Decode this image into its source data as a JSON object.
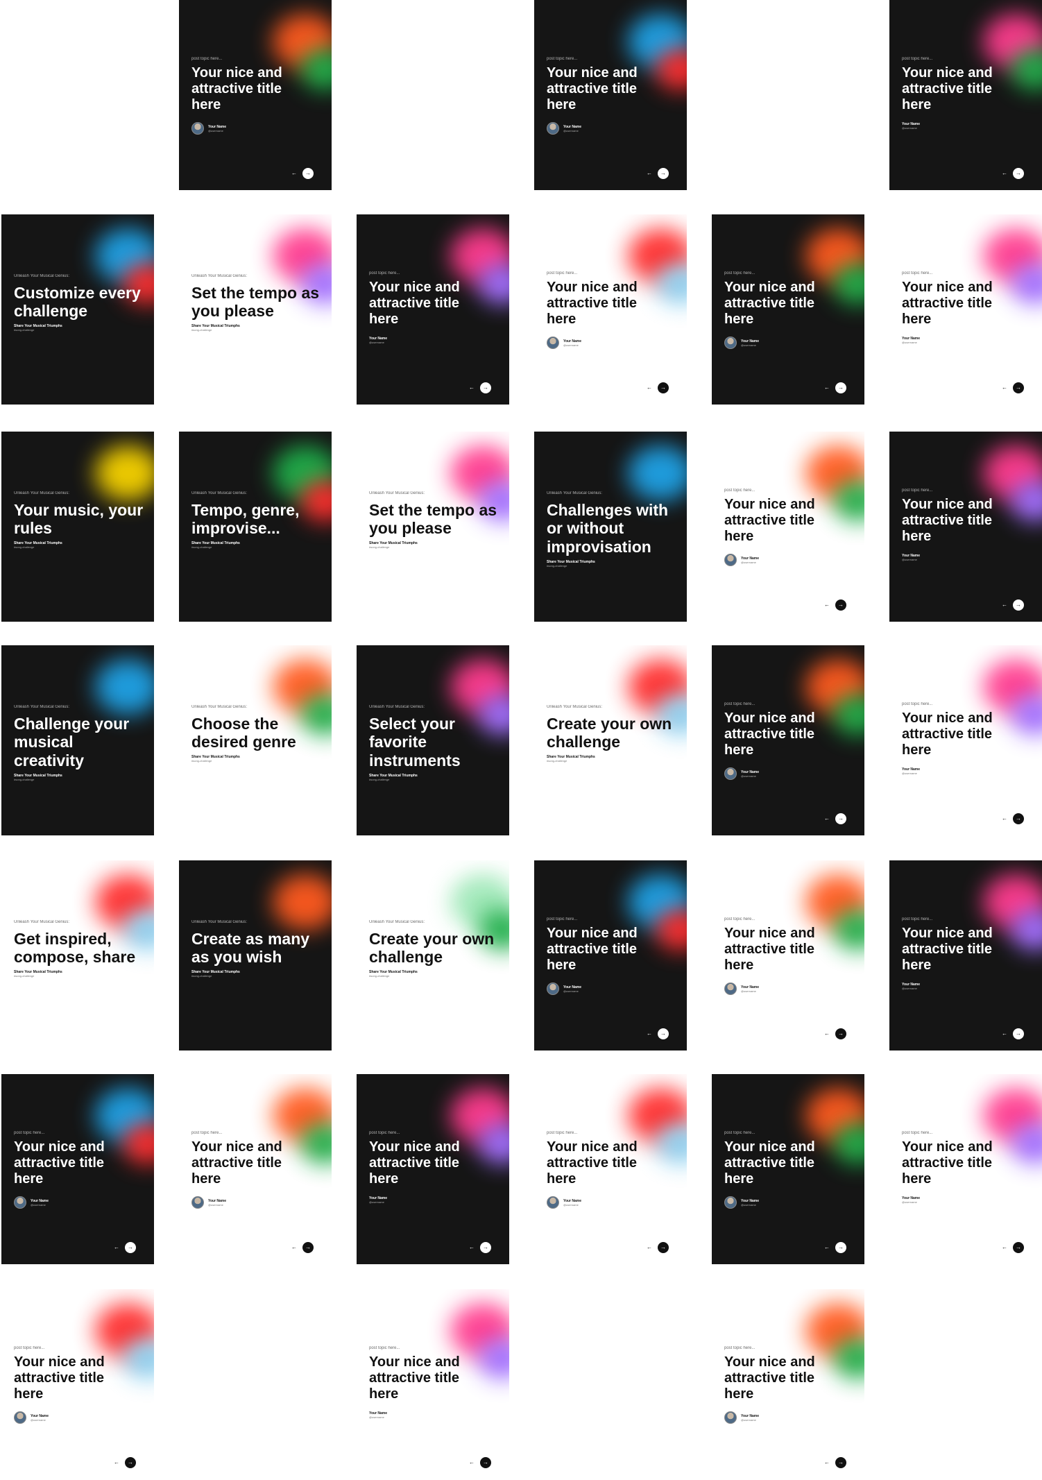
{
  "colors": {
    "dark_bg": "#151515",
    "light_bg": "#ffffff",
    "orange": "#ff5a1f",
    "blue": "#1fa2e6",
    "pink": "#ff3c8e",
    "red": "#ff2d2d",
    "green": "#1fae4a",
    "purple": "#a070ff",
    "yellow": "#f6d200",
    "light_blue": "#8cd0f0",
    "mint": "#9fe8b8"
  },
  "common": {
    "topic": "post topic here...",
    "title": "Your nice and attractive title here",
    "author_name": "Your Name",
    "author_handle": "@username",
    "promo_topic": "Unleash Your Musical Genius:",
    "cta_main": "Share Your Musical Triumphs",
    "cta_tag": "#song-challenge",
    "prev_icon": "←",
    "next_icon": "→"
  },
  "cards": [
    {
      "theme": "dark",
      "kind": "post",
      "palette": [
        "orange",
        "green"
      ],
      "show_avatar": true,
      "show_nav": true
    },
    {
      "theme": "dark",
      "kind": "post",
      "palette": [
        "blue",
        "red"
      ],
      "show_avatar": true,
      "show_nav": true
    },
    {
      "theme": "dark",
      "kind": "post",
      "palette": [
        "pink",
        "green"
      ],
      "show_avatar": false,
      "show_nav": true
    },
    {
      "theme": "dark",
      "kind": "promo",
      "title": "Customize every challenge",
      "palette": [
        "blue",
        "red"
      ]
    },
    {
      "theme": "light",
      "kind": "promo",
      "title": "Set the tempo as you please",
      "palette": [
        "pink",
        "purple"
      ]
    },
    {
      "theme": "dark",
      "kind": "post",
      "palette": [
        "pink",
        "purple"
      ],
      "show_avatar": false,
      "show_nav": true
    },
    {
      "theme": "light",
      "kind": "post",
      "palette": [
        "red",
        "light_blue"
      ],
      "show_avatar": true,
      "show_nav": true
    },
    {
      "theme": "dark",
      "kind": "post",
      "palette": [
        "orange",
        "green"
      ],
      "show_avatar": true,
      "show_nav": true
    },
    {
      "theme": "light",
      "kind": "post",
      "palette": [
        "pink",
        "purple"
      ],
      "show_avatar": false,
      "show_nav": true
    },
    {
      "theme": "dark",
      "kind": "promo",
      "title": "Your music, your rules",
      "palette": [
        "yellow"
      ]
    },
    {
      "theme": "dark",
      "kind": "promo",
      "title": "Tempo, genre, improvise...",
      "palette": [
        "green",
        "red"
      ]
    },
    {
      "theme": "light",
      "kind": "promo",
      "title": "Set the tempo as you please",
      "palette": [
        "pink",
        "purple"
      ]
    },
    {
      "theme": "dark",
      "kind": "promo",
      "title": "Challenges with or without improvisation",
      "palette": [
        "blue"
      ]
    },
    {
      "theme": "light",
      "kind": "post",
      "palette": [
        "orange",
        "green"
      ],
      "show_avatar": true,
      "show_nav": true
    },
    {
      "theme": "dark",
      "kind": "post",
      "palette": [
        "pink",
        "purple"
      ],
      "show_avatar": false,
      "show_nav": true
    },
    {
      "theme": "dark",
      "kind": "promo",
      "title": "Challenge your musical creativity",
      "palette": [
        "blue"
      ]
    },
    {
      "theme": "light",
      "kind": "promo",
      "title": "Choose the desired genre",
      "palette": [
        "orange",
        "green"
      ]
    },
    {
      "theme": "dark",
      "kind": "promo",
      "title": "Select your favorite instruments",
      "palette": [
        "pink",
        "purple"
      ]
    },
    {
      "theme": "light",
      "kind": "promo",
      "title": "Create your own challenge",
      "palette": [
        "red",
        "light_blue"
      ]
    },
    {
      "theme": "dark",
      "kind": "post",
      "palette": [
        "orange",
        "green"
      ],
      "show_avatar": true,
      "show_nav": true
    },
    {
      "theme": "light",
      "kind": "post",
      "palette": [
        "pink",
        "purple"
      ],
      "show_avatar": false,
      "show_nav": true
    },
    {
      "theme": "light",
      "kind": "promo",
      "title": "Get inspired, compose, share",
      "palette": [
        "red",
        "light_blue"
      ]
    },
    {
      "theme": "dark",
      "kind": "promo",
      "title": "Create as many as you wish",
      "palette": [
        "orange"
      ]
    },
    {
      "theme": "light",
      "kind": "promo",
      "title": "Create your own challenge",
      "palette": [
        "mint",
        "green"
      ]
    },
    {
      "theme": "dark",
      "kind": "post",
      "palette": [
        "blue",
        "red"
      ],
      "show_avatar": true,
      "show_nav": true
    },
    {
      "theme": "light",
      "kind": "post",
      "palette": [
        "orange",
        "green"
      ],
      "show_avatar": true,
      "show_nav": true
    },
    {
      "theme": "dark",
      "kind": "post",
      "palette": [
        "pink",
        "purple"
      ],
      "show_avatar": false,
      "show_nav": true
    },
    {
      "theme": "dark",
      "kind": "post",
      "palette": [
        "blue",
        "red"
      ],
      "show_avatar": true,
      "show_nav": true
    },
    {
      "theme": "light",
      "kind": "post",
      "palette": [
        "orange",
        "green"
      ],
      "show_avatar": true,
      "show_nav": true
    },
    {
      "theme": "dark",
      "kind": "post",
      "palette": [
        "pink",
        "purple"
      ],
      "show_avatar": false,
      "show_nav": true
    },
    {
      "theme": "light",
      "kind": "post",
      "palette": [
        "red",
        "light_blue"
      ],
      "show_avatar": true,
      "show_nav": true
    },
    {
      "theme": "dark",
      "kind": "post",
      "palette": [
        "orange",
        "green"
      ],
      "show_avatar": true,
      "show_nav": true
    },
    {
      "theme": "light",
      "kind": "post",
      "palette": [
        "pink",
        "purple"
      ],
      "show_avatar": false,
      "show_nav": true
    },
    {
      "theme": "light",
      "kind": "post",
      "palette": [
        "red",
        "light_blue"
      ],
      "show_avatar": true,
      "show_nav": true
    },
    {
      "theme": "light",
      "kind": "post",
      "palette": [
        "pink",
        "purple"
      ],
      "show_avatar": false,
      "show_nav": true
    },
    {
      "theme": "light",
      "kind": "post",
      "palette": [
        "orange",
        "green"
      ],
      "show_avatar": true,
      "show_nav": true
    }
  ]
}
